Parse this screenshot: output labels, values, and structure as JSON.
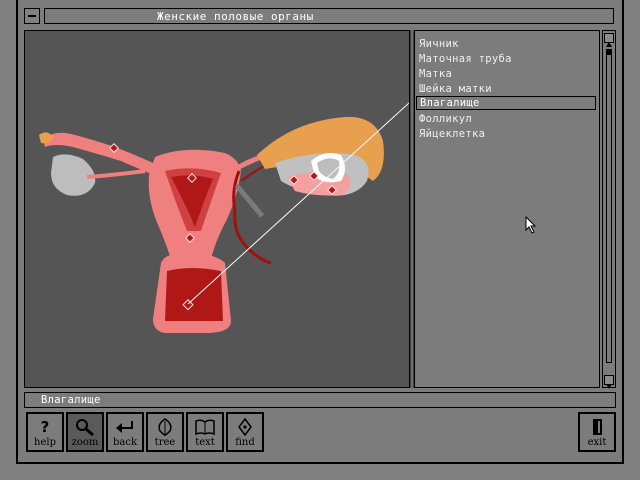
{
  "window": {
    "title": "Женские половые органы"
  },
  "list": {
    "items": [
      {
        "label": "Яичник"
      },
      {
        "label": "Маточная труба"
      },
      {
        "label": "Матка"
      },
      {
        "label": "Шейка матки"
      },
      {
        "label": "Влагалище",
        "selected": true
      },
      {
        "label": "Фолликул"
      },
      {
        "label": "Яйцеклетка"
      }
    ]
  },
  "status": {
    "text": "Влагалище"
  },
  "toolbar": {
    "help": {
      "label": "help",
      "icon": "question-mark-icon"
    },
    "zoom": {
      "label": "zoom",
      "icon": "magnifier-icon",
      "active": true
    },
    "back": {
      "label": "back",
      "icon": "return-arrow-icon"
    },
    "tree": {
      "label": "tree",
      "icon": "leaf-icon"
    },
    "text": {
      "label": "text",
      "icon": "open-book-icon"
    },
    "find": {
      "label": "find",
      "icon": "pen-nib-icon"
    },
    "exit": {
      "label": "exit",
      "icon": "door-icon"
    }
  },
  "colors": {
    "viewer_bg": "#555555",
    "organ_pink": "#f08080",
    "organ_red": "#b01818",
    "fimbria_orange": "#e8a050",
    "ovary_pink": "#f4a0a0"
  }
}
